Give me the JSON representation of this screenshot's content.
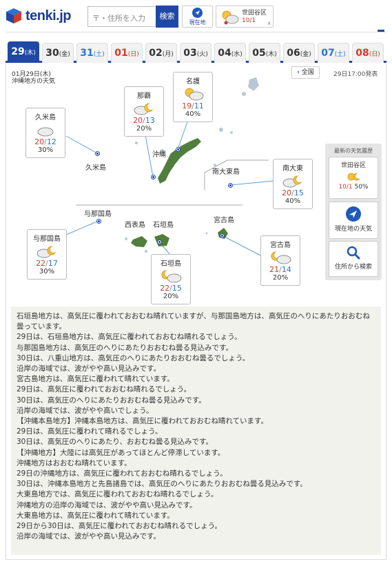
{
  "header": {
    "logo_text": "tenki.jp",
    "search_placeholder": "〒・住所を入力",
    "search_button": "検索",
    "current_location": "現在地",
    "history_card": {
      "name": "世田谷区",
      "temp": "10/1",
      "close": "x"
    }
  },
  "tabs": [
    {
      "day": "29",
      "dow": "(木)",
      "type": "selected"
    },
    {
      "day": "30",
      "dow": "(金)",
      "type": "weekday"
    },
    {
      "day": "31",
      "dow": "(土)",
      "type": "sat"
    },
    {
      "day": "01",
      "dow": "(日)",
      "type": "sun"
    },
    {
      "day": "02",
      "dow": "(月)",
      "type": "weekday"
    },
    {
      "day": "03",
      "dow": "(火)",
      "type": "weekday"
    },
    {
      "day": "04",
      "dow": "(水)",
      "type": "weekday"
    },
    {
      "day": "05",
      "dow": "(木)",
      "type": "weekday"
    },
    {
      "day": "06",
      "dow": "(金)",
      "type": "weekday"
    },
    {
      "day": "07",
      "dow": "(土)",
      "type": "sat"
    },
    {
      "day": "08",
      "dow": "(日)",
      "type": "sun"
    }
  ],
  "forecast": {
    "date": "01月29日(木)",
    "region": "沖縄地方の天気",
    "back_button": "全国",
    "issued": "29日17:00発表"
  },
  "cities": [
    {
      "name": "久米島",
      "hi": "20",
      "lo": "12",
      "pop": "30%",
      "icon": "cloudy-icon"
    },
    {
      "name": "那覇",
      "hi": "20",
      "lo": "13",
      "pop": "20%",
      "icon": "cloudy-then-clear-icon"
    },
    {
      "name": "名護",
      "hi": "19",
      "lo": "11",
      "pop": "40%",
      "icon": "sun-then-cloudy-icon"
    },
    {
      "name": "南大東",
      "hi": "20",
      "lo": "15",
      "pop": "40%",
      "icon": "cloudy-then-clear-icon"
    },
    {
      "name": "与那国島",
      "hi": "22",
      "lo": "17",
      "pop": "30%",
      "icon": "cloudy-then-clear-icon"
    },
    {
      "name": "石垣島",
      "hi": "22",
      "lo": "15",
      "pop": "20%",
      "icon": "clear-then-cloudy-icon"
    },
    {
      "name": "宮古島",
      "hi": "21",
      "lo": "14",
      "pop": "20%",
      "icon": "clear-then-cloudy-icon"
    }
  ],
  "map_labels": {
    "kumejima": "久米島",
    "okinawa": "沖縄",
    "minamidaito": "南大東島",
    "yonaguni": "与那国島",
    "iriomote": "西表島",
    "ishigaki": "石垣島",
    "miyako": "宮古島"
  },
  "sidebar": {
    "title": "最新の天気履歴",
    "history": {
      "name": "世田谷区",
      "temp": "10/1",
      "pop": "50%"
    },
    "current_weather": "現在地の天気",
    "address_search": "住所から検索"
  },
  "description": [
    "石垣島地方は、高気圧に覆われておおむね晴れていますが、与那国島地方は、高気圧のへりにあたりおおむね曇っています。",
    "29日は、石垣島地方は、高気圧に覆われておおむね晴れるでしょう。",
    "与那国島地方は、高気圧のへりにあたりおおむね曇る見込みです。",
    "30日は、八重山地方は、高気圧のへりにあたりおおむね曇るでしょう。",
    "沿岸の海域では、波がやや高い見込みです。",
    "宮古島地方は、高気圧に覆われて晴れています。",
    "29日は、高気圧に覆われておおむね晴れるでしょう。",
    "30日は、高気圧のへりにあたりおおむね曇る見込みです。",
    "沿岸の海域では、波がやや高いでしょう。",
    "【沖縄本島地方】沖縄本島地方は、高気圧に覆われておおむね晴れています。",
    "29日は、高気圧に覆われて晴れるでしょう。",
    "30日は、高気圧のへりにあたり、おおむね曇る見込みです。",
    "【沖縄地方】大陸には高気圧があってほとんど停滞しています。",
    "沖縄地方はおおむね晴れています。",
    "29日の沖縄地方は、高気圧に覆われておおむね晴れるでしょう。",
    "30日は、沖縄本島地方と先島諸島では、高気圧のへりにあたりおおむね曇る見込みです。",
    "大東島地方では、高気圧に覆われておおむね晴れるでしょう。",
    "沖縄地方の沿岸の海域では、波がやや高い見込みです。",
    "大東島地方は、高気圧に覆われて晴れています。",
    "29日から30日は、高気圧に覆われておおむね晴れるでしょう。",
    "沿岸の海域では、波がやや高い見込みです。"
  ],
  "colors": {
    "brand": "#1f47a6",
    "high": "#d23a2a",
    "low": "#2a73d0",
    "land": "#4f7f3a"
  }
}
